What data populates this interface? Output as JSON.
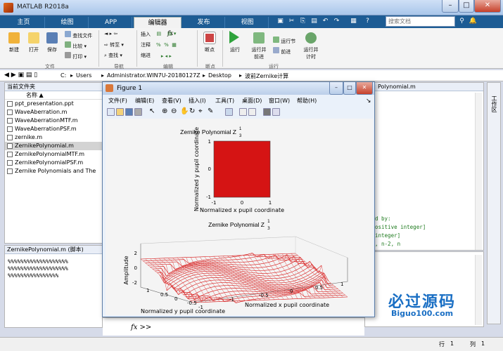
{
  "window": {
    "title": "MATLAB R2018a"
  },
  "tabs": [
    "主页",
    "绘图",
    "APP",
    "编辑器",
    "发布",
    "视图"
  ],
  "search": {
    "placeholder": "搜索文档"
  },
  "ribbon": {
    "new": "新建",
    "open": "打开",
    "save": "保存",
    "find_files": "查找文件",
    "compare": "比较",
    "print": "打印",
    "goto": "转至",
    "find": "查找",
    "insert": "插入",
    "fx": "fx",
    "comment": "注释",
    "indent": "缩进",
    "breakpoints": "断点",
    "run": "运行",
    "run_advance": "运行并\n前进",
    "run_section": "运行节",
    "advance": "前进",
    "run_time": "运行并\n计时",
    "group_file": "文件",
    "group_nav": "导航",
    "group_edit": "编辑",
    "group_bp": "断点",
    "group_run": "运行"
  },
  "address": {
    "path": [
      "C:",
      "Users",
      "Administrator.WIN7U-20180127Z",
      "Desktop",
      "波前Zernike计算"
    ]
  },
  "files": {
    "header": "当前文件夹",
    "col_name": "名称",
    "items": [
      "ppt_presentation.ppt",
      "WaveAberration.m",
      "WaveAberrationMTF.m",
      "WaveAberrationPSF.m",
      "zernike.m",
      "ZernikePolynomial.m",
      "ZernikePolynomialMTF.m",
      "ZernikePolynomialPSF.m",
      "Zernike Polynomials and The"
    ],
    "selected": 5
  },
  "detail": {
    "header": "ZernikePolynomial.m  (脚本)",
    "lines": [
      "%%%%%%%%%%%%%%%%%%%",
      "%%%%%%%%%%%%%%%%%%%",
      "%%%%%%%%%%%%%%%%"
    ]
  },
  "editor": {
    "tab": "Polynomial.m",
    "side": "工作区",
    "lines": [
      "d by:",
      "ositive integer]",
      "integer]",
      ", n-2, n"
    ]
  },
  "command": {
    "prompt": "fx >>"
  },
  "status": {
    "row_label": "行",
    "row": "1",
    "col_label": "列",
    "col": "1"
  },
  "figure": {
    "title": "Figure 1",
    "menu": [
      "文件(F)",
      "编辑(E)",
      "查看(V)",
      "插入(I)",
      "工具(T)",
      "桌面(D)",
      "窗口(W)",
      "帮助(H)"
    ]
  },
  "plot_top": {
    "title": "Zernike Polynomial  Z",
    "sup": "1",
    "sub": "3",
    "xlabel": "Normalized x pupil coordinate",
    "ylabel": "Normalized y pupil coordinate",
    "xticks": [
      "-1",
      "0",
      "1"
    ],
    "yticks": [
      "1",
      "0",
      "-1"
    ],
    "fill": "#d51414"
  },
  "plot_bottom": {
    "title": "Zernike Polynomial  Z",
    "sup": "1",
    "sub": "3",
    "zlabel": "Amplitude",
    "xlabel": "Normalized x pupil coordinate",
    "ylabel": "Normalized y pupil coordinate",
    "zticks": [
      "2",
      "0",
      "-2"
    ],
    "yticks": [
      "1",
      "0.5",
      "0",
      "-0.5",
      "-1"
    ],
    "xticks": [
      "-1",
      "-0.5",
      "0",
      "0.5",
      "1"
    ]
  },
  "watermark": {
    "text": "必过源码",
    "url": "Biguo100.com"
  }
}
